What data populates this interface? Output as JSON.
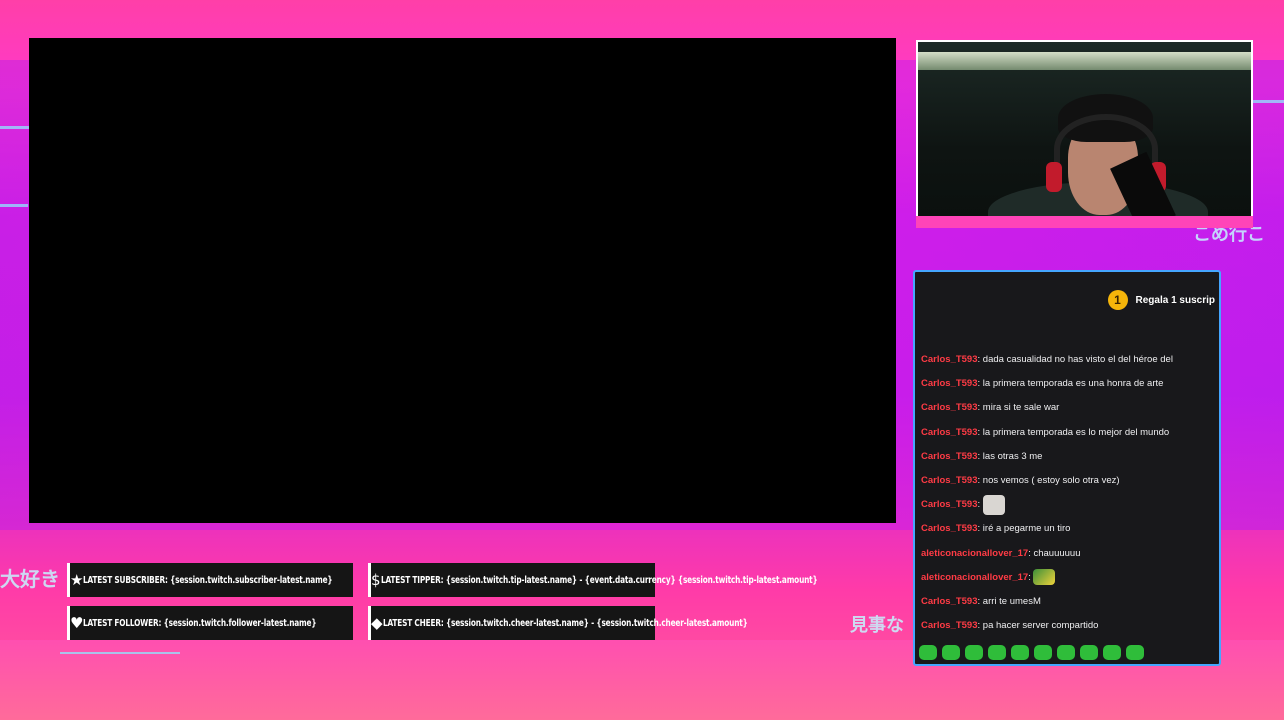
{
  "background": {
    "japanese_left": "大好き",
    "japanese_right_top": "こめ行こ",
    "japanese_right_bottom": "見事な"
  },
  "colors": {
    "chat_username": "#ff3b45",
    "chat_border": "#45a6ff",
    "chat_background": "#18181b",
    "gift_badge": "#f5b50a"
  },
  "chat": {
    "gift_badge_count": "1",
    "gift_text": "Regala 1 suscrip",
    "messages": [
      {
        "user": "Carlos_T593",
        "sep": ": ",
        "text": "dada casualidad no has visto el del héroe del",
        "emote": ""
      },
      {
        "user": "Carlos_T593",
        "sep": ": ",
        "text": "la primera temporada es una honra de arte",
        "emote": ""
      },
      {
        "user": "Carlos_T593",
        "sep": ": ",
        "text": "mira si te sale war",
        "emote": ""
      },
      {
        "user": "Carlos_T593",
        "sep": ": ",
        "text": "la primera temporada es lo mejor del mundo",
        "emote": ""
      },
      {
        "user": "Carlos_T593",
        "sep": ": ",
        "text": "las otras 3 me",
        "emote": ""
      },
      {
        "user": "Carlos_T593",
        "sep": ": ",
        "text": "nos vemos ( estoy solo otra vez)",
        "emote": ""
      },
      {
        "user": "Carlos_T593",
        "sep": ": ",
        "text": "",
        "emote": "cat-emote"
      },
      {
        "user": "Carlos_T593",
        "sep": ": ",
        "text": "iré a pegarme un tiro",
        "emote": ""
      },
      {
        "user": "aleticonacionallover_17",
        "sep": ": ",
        "text": "chauuuuuu",
        "emote": ""
      },
      {
        "user": "aleticonacionallover_17",
        "sep": ": ",
        "text": "",
        "emote": "frog-emote"
      },
      {
        "user": "Carlos_T593",
        "sep": ": ",
        "text": "arri te umesM",
        "emote": ""
      },
      {
        "user": "Carlos_T593",
        "sep": ": ",
        "text": "pa hacer server compartido",
        "emote": ""
      }
    ],
    "emote_bar": [
      "emote-1",
      "emote-2",
      "emote-3",
      "emote-4",
      "emote-5",
      "emote-6",
      "emote-7",
      "emote-8",
      "emote-9",
      "emote-10"
    ]
  },
  "tickers": [
    {
      "icon": "★",
      "icon_name": "star-icon",
      "label": "LATEST SUBSCRIBER: {session.twitch.subscriber-latest.name}"
    },
    {
      "icon": "$",
      "icon_name": "dollar-icon",
      "label": "LATEST TIPPER: {session.twitch.tip-latest.name} - {event.data.currency} {session.twitch.tip-latest.amount}"
    },
    {
      "icon": "♥",
      "icon_name": "heart-icon",
      "label": "LATEST FOLLOWER: {session.twitch.follower-latest.name}"
    },
    {
      "icon": "◆",
      "icon_name": "diamond-icon",
      "label": "LATEST CHEER: {session.twitch.cheer-latest.name} - {session.twitch.cheer-latest.amount}"
    }
  ]
}
